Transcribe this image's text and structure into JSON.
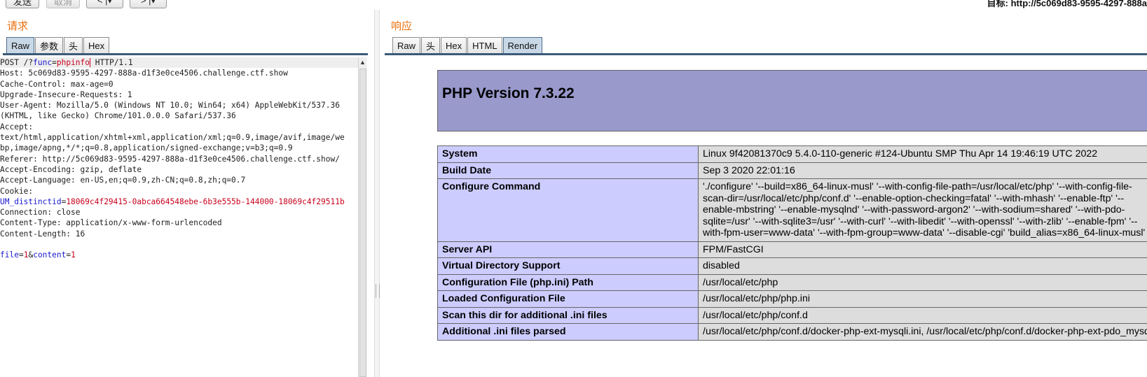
{
  "toolbar": {
    "send_label": "发送",
    "cancel_label": "取消",
    "back_icon": "chevron-left-icon",
    "forward_icon": "chevron-right-icon",
    "target": "目标: http://5c069d83-9595-4297-888a"
  },
  "request": {
    "title": "请求",
    "tabs": [
      "Raw",
      "参数",
      "头",
      "Hex"
    ],
    "active_tab": "Raw",
    "lines": [
      "POST /?func=phpinfo HTTP/1.1",
      "Host: 5c069d83-9595-4297-888a-d1f3e0ce4506.challenge.ctf.show",
      "Cache-Control: max-age=0",
      "Upgrade-Insecure-Requests: 1",
      "User-Agent: Mozilla/5.0 (Windows NT 10.0; Win64; x64) AppleWebKit/537.36",
      "(KHTML, like Gecko) Chrome/101.0.0.0 Safari/537.36",
      "Accept:",
      "text/html,application/xhtml+xml,application/xml;q=0.9,image/avif,image/we",
      "bp,image/apng,*/*;q=0.8,application/signed-exchange;v=b3;q=0.9",
      "Referer: http://5c069d83-9595-4297-888a-d1f3e0ce4506.challenge.ctf.show/",
      "Accept-Encoding: gzip, deflate",
      "Accept-Language: en-US,en;q=0.9,zh-CN;q=0.8,zh;q=0.7",
      "Cookie:",
      "UM_distinctid=18069c4f29415-0abca664548ebe-6b3e555b-144000-18069c4f29511b",
      "Connection: close",
      "Content-Type: application/x-www-form-urlencoded",
      "Content-Length: 16",
      "",
      "file=1&content=1"
    ]
  },
  "response": {
    "title": "响应",
    "tabs": [
      "Raw",
      "头",
      "Hex",
      "HTML",
      "Render"
    ],
    "active_tab": "Render",
    "php_version": "PHP Version 7.3.22",
    "rows": [
      {
        "key": "System",
        "value": "Linux 9f42081370c9 5.4.0-110-generic #124-Ubuntu SMP Thu Apr 14 19:46:19 UTC 2022"
      },
      {
        "key": "Build Date",
        "value": "Sep 3 2020 22:01:16"
      },
      {
        "key": "Configure Command",
        "value": "'./configure' '--build=x86_64-linux-musl' '--with-config-file-path=/usr/local/etc/php' '--with-config-file-scan-dir=/usr/local/etc/php/conf.d' '--enable-option-checking=fatal' '--with-mhash' '--enable-ftp' '--enable-mbstring' '--enable-mysqlnd' '--with-password-argon2' '--with-sodium=shared' '--with-pdo-sqlite=/usr' '--with-sqlite3=/usr' '--with-curl' '--with-libedit' '--with-openssl' '--with-zlib' '--enable-fpm' '--with-fpm-user=www-data' '--with-fpm-group=www-data' '--disable-cgi' 'build_alias=x86_64-linux-musl'"
      },
      {
        "key": "Server API",
        "value": "FPM/FastCGI"
      },
      {
        "key": "Virtual Directory Support",
        "value": "disabled"
      },
      {
        "key": "Configuration File (php.ini) Path",
        "value": "/usr/local/etc/php"
      },
      {
        "key": "Loaded Configuration File",
        "value": "/usr/local/etc/php/php.ini"
      },
      {
        "key": "Scan this dir for additional .ini files",
        "value": "/usr/local/etc/php/conf.d"
      },
      {
        "key": "Additional .ini files parsed",
        "value": "/usr/local/etc/php/conf.d/docker-php-ext-mysqli.ini, /usr/local/etc/php/conf.d/docker-php-ext-pdo_mysql.ini"
      }
    ]
  },
  "colors": {
    "section_title": "#e8700f",
    "php_header": "#9999cc",
    "key_cell": "#ccccff",
    "value_cell": "#dddddd",
    "param_name": "#1a1ad0",
    "param_value": "#c8001c"
  }
}
